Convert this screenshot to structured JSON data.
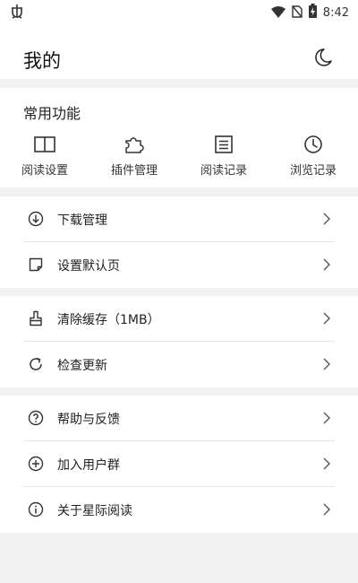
{
  "status_bar": {
    "time": "8:42",
    "left_icon": "notification-bug-icon",
    "icons": [
      "wifi-icon",
      "no-sim-icon",
      "battery-charging-icon"
    ]
  },
  "header": {
    "title": "我的",
    "night_mode_icon": "moon-icon"
  },
  "quick_functions": {
    "title": "常用功能",
    "items": [
      {
        "label": "阅读设置",
        "icon": "book-icon"
      },
      {
        "label": "插件管理",
        "icon": "puzzle-icon"
      },
      {
        "label": "阅读记录",
        "icon": "document-list-icon"
      },
      {
        "label": "浏览记录",
        "icon": "clock-icon"
      }
    ]
  },
  "menu_groups": [
    [
      {
        "label": "下载管理",
        "icon": "download-icon"
      },
      {
        "label": "设置默认页",
        "icon": "page-icon"
      }
    ],
    [
      {
        "label": "清除缓存（1MB）",
        "icon": "broom-icon"
      },
      {
        "label": "检查更新",
        "icon": "refresh-icon"
      }
    ],
    [
      {
        "label": "帮助与反馈",
        "icon": "help-icon"
      },
      {
        "label": "加入用户群",
        "icon": "add-circle-icon"
      },
      {
        "label": "关于星际阅读",
        "icon": "info-icon"
      }
    ]
  ],
  "colors": {
    "background": "#f2f2f2",
    "card": "#ffffff",
    "text": "#222222",
    "divider": "#e6e6e6"
  }
}
